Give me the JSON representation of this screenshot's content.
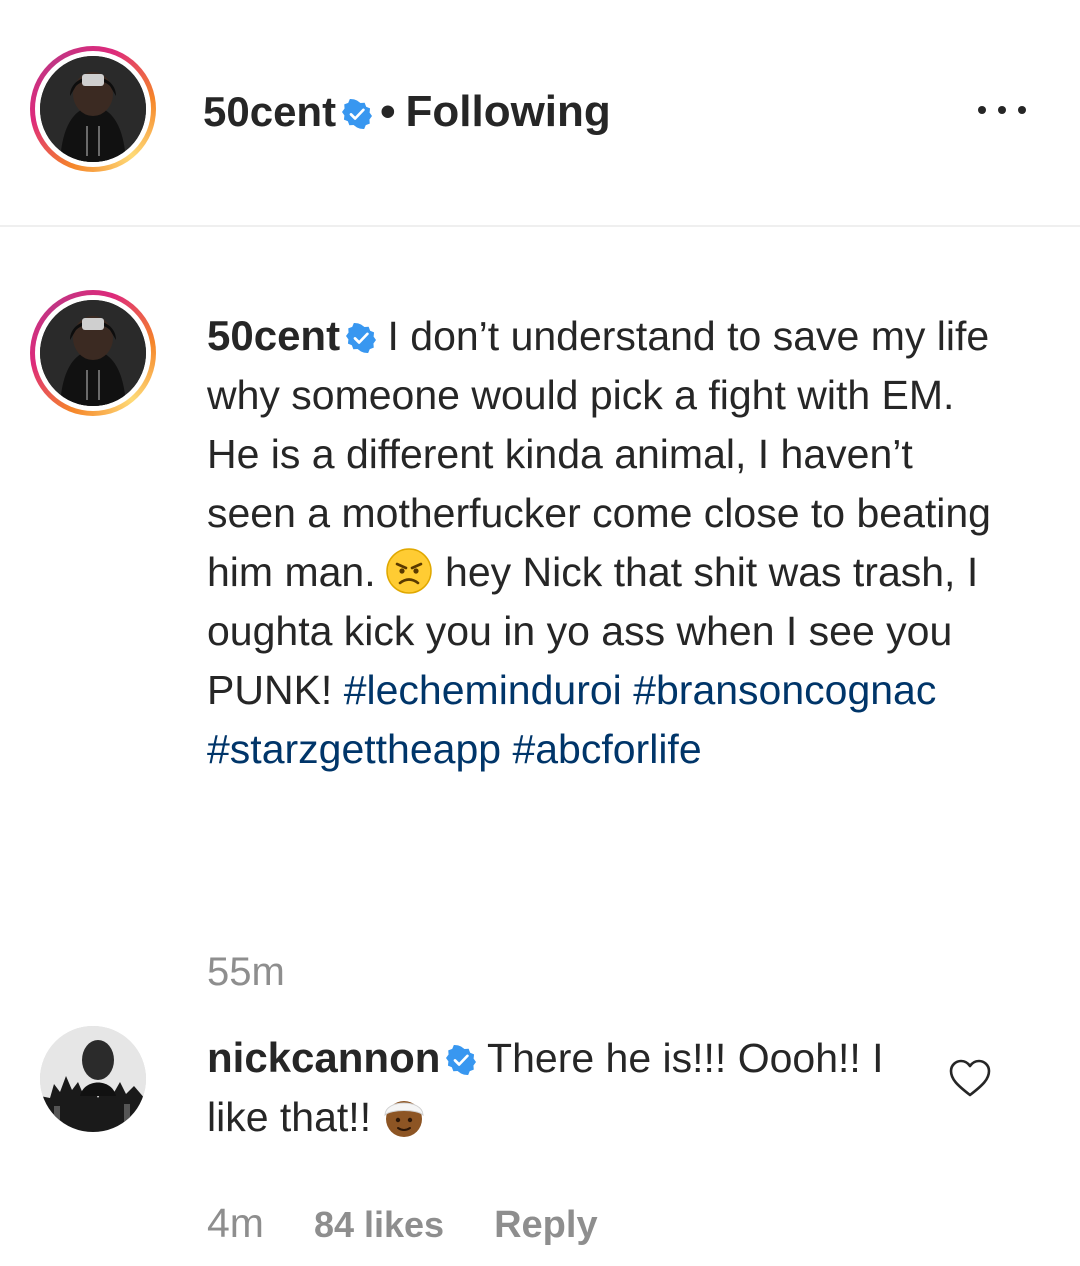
{
  "header": {
    "username": "50cent",
    "separator": "•",
    "follow_status": "Following",
    "more_icon": "more-dots-icon"
  },
  "post": {
    "username": "50cent",
    "caption_text": "I don’t understand to save my life why someone would pick a fight with EM. He is a different kinda animal, I haven’t seen a motherfucker come close to beating him man.",
    "caption_emoji": "angry-face-emoji",
    "caption_text_2": "hey Nick that shit was trash, I oughta kick you in yo ass when I see you PUNK!",
    "hashtags": [
      "#lecheminduroi",
      "#bransoncognac",
      "#starzgettheapp",
      "#abcforlife"
    ],
    "time": "55m"
  },
  "comment": {
    "username": "nickcannon",
    "text": "There he is!!! Oooh!! I like that!!",
    "emoji": "person-with-turban-emoji",
    "time": "4m",
    "likes": "84 likes",
    "reply_label": "Reply",
    "like_icon": "heart-outline-icon"
  },
  "colors": {
    "text": "#262626",
    "muted": "#8e8e8e",
    "hashtag": "#003569",
    "verified": "#3897f0",
    "divider": "#efefef"
  }
}
